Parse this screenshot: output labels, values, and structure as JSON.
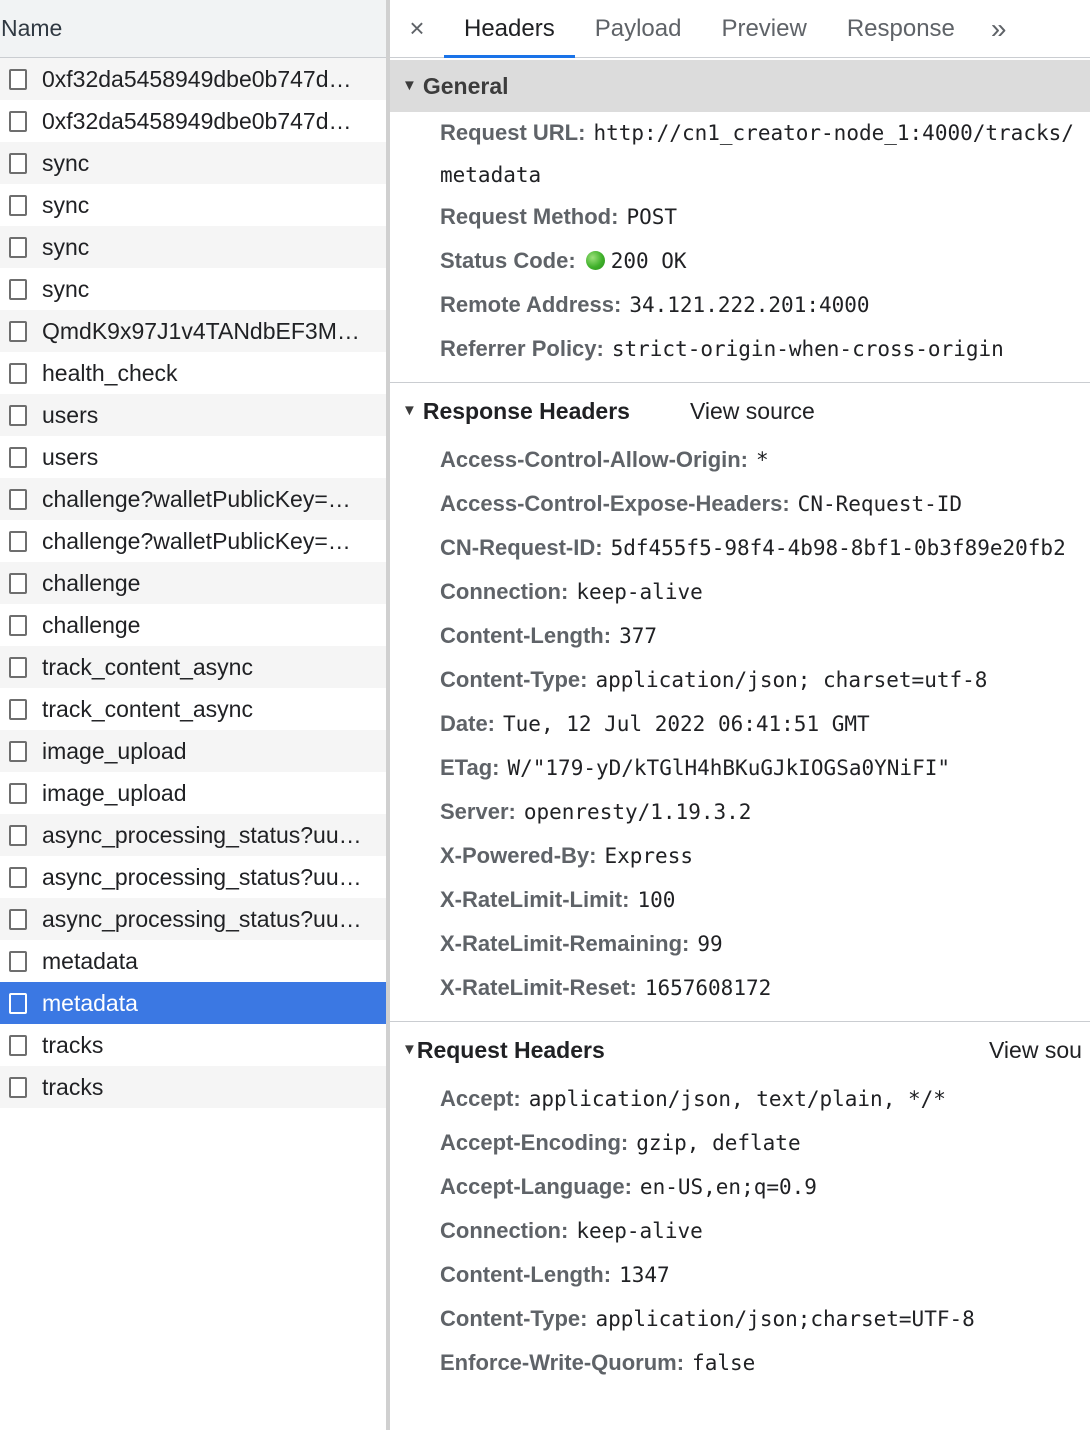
{
  "request_list": {
    "header": "Name",
    "items": [
      "0xf32da5458949dbe0b747d…",
      "0xf32da5458949dbe0b747d…",
      "sync",
      "sync",
      "sync",
      "sync",
      "QmdK9x97J1v4TANdbEF3M…",
      "health_check",
      "users",
      "users",
      "challenge?walletPublicKey=…",
      "challenge?walletPublicKey=…",
      "challenge",
      "challenge",
      "track_content_async",
      "track_content_async",
      "image_upload",
      "image_upload",
      "async_processing_status?uu…",
      "async_processing_status?uu…",
      "async_processing_status?uu…",
      "metadata",
      "metadata",
      "tracks",
      "tracks"
    ],
    "selected_index": 22
  },
  "tabs": {
    "close": "×",
    "items": [
      "Headers",
      "Payload",
      "Preview",
      "Response"
    ],
    "active": "Headers",
    "more": "»"
  },
  "general": {
    "title": "General",
    "rows": [
      {
        "key": "Request URL:",
        "value": "http://cn1_creator-node_1:4000/tracks/metadata"
      },
      {
        "key": "Request Method:",
        "value": "POST"
      },
      {
        "key": "Status Code:",
        "value": "200 OK",
        "status_color": "#3fb02a"
      },
      {
        "key": "Remote Address:",
        "value": "34.121.222.201:4000"
      },
      {
        "key": "Referrer Policy:",
        "value": "strict-origin-when-cross-origin"
      }
    ]
  },
  "response_headers": {
    "title": "Response Headers",
    "view_source": "View source",
    "rows": [
      {
        "key": "Access-Control-Allow-Origin:",
        "value": "*"
      },
      {
        "key": "Access-Control-Expose-Headers:",
        "value": "CN-Request-ID"
      },
      {
        "key": "CN-Request-ID:",
        "value": "5df455f5-98f4-4b98-8bf1-0b3f89e20fb2"
      },
      {
        "key": "Connection:",
        "value": "keep-alive"
      },
      {
        "key": "Content-Length:",
        "value": "377"
      },
      {
        "key": "Content-Type:",
        "value": "application/json; charset=utf-8"
      },
      {
        "key": "Date:",
        "value": "Tue, 12 Jul 2022 06:41:51 GMT"
      },
      {
        "key": "ETag:",
        "value": "W/\"179-yD/kTGlH4hBKuGJkIOGSa0YNiFI\""
      },
      {
        "key": "Server:",
        "value": "openresty/1.19.3.2"
      },
      {
        "key": "X-Powered-By:",
        "value": "Express"
      },
      {
        "key": "X-RateLimit-Limit:",
        "value": "100"
      },
      {
        "key": "X-RateLimit-Remaining:",
        "value": "99"
      },
      {
        "key": "X-RateLimit-Reset:",
        "value": "1657608172"
      }
    ]
  },
  "request_headers": {
    "title": "Request Headers",
    "view_source": "View sou",
    "rows": [
      {
        "key": "Accept:",
        "value": "application/json, text/plain, */*"
      },
      {
        "key": "Accept-Encoding:",
        "value": "gzip, deflate"
      },
      {
        "key": "Accept-Language:",
        "value": "en-US,en;q=0.9"
      },
      {
        "key": "Connection:",
        "value": "keep-alive"
      },
      {
        "key": "Content-Length:",
        "value": "1347"
      },
      {
        "key": "Content-Type:",
        "value": "application/json;charset=UTF-8"
      },
      {
        "key": "Enforce-Write-Quorum:",
        "value": "false"
      }
    ]
  },
  "colors": {
    "selected_row": "#3b78e3",
    "active_tab_underline": "#1a73e8",
    "status_ok": "#3fb02a"
  }
}
